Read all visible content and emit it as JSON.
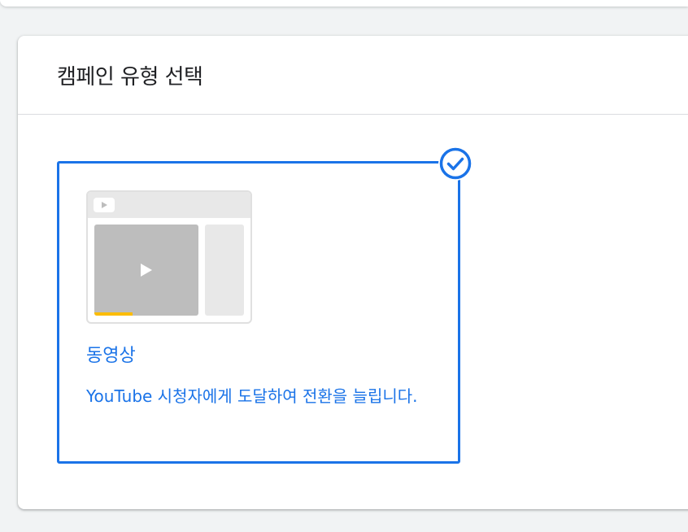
{
  "header": {
    "title": "캠페인 유형 선택"
  },
  "campaign_types": [
    {
      "title": "동영상",
      "description": "YouTube 시청자에게 도달하여 전환을 늘립니다.",
      "selected": true,
      "selected_icon": "check-circle-icon",
      "thumbnail_icon": "video-play-icon",
      "progress": 0.37
    }
  ],
  "colors": {
    "accent": "#1a73e8",
    "progress": "#fbbc04",
    "placeholder": "#bdbdbd",
    "placeholder_light": "#e8e8e8"
  }
}
